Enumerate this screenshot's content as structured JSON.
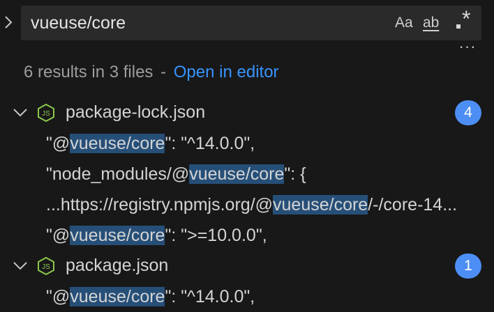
{
  "search": {
    "query": "vueuse/core",
    "match_case_label": "Aa",
    "whole_word_label": "ab",
    "regex_label": "*",
    "more_label": "···"
  },
  "summary": {
    "results_text": "6 results in 3 files",
    "separator": "-",
    "open_in_editor": "Open in editor"
  },
  "files": [
    {
      "name": "package-lock.json",
      "count": "4",
      "matches": [
        {
          "pre": "\"@",
          "match": "vueuse/core",
          "post": "\": \"^14.0.0\","
        },
        {
          "pre": "\"node_modules/@",
          "match": "vueuse/core",
          "post": "\": {"
        },
        {
          "pre": "...https://registry.npmjs.org/@",
          "match": "vueuse/core",
          "post": "/-/core-14..."
        },
        {
          "pre": "\"@",
          "match": "vueuse/core",
          "post": "\": \">=10.0.0\","
        }
      ]
    },
    {
      "name": "package.json",
      "count": "1",
      "matches": [
        {
          "pre": "\"@",
          "match": "vueuse/core",
          "post": "\": \"^14.0.0\","
        }
      ]
    }
  ],
  "colors": {
    "background": "#181818",
    "input_background": "#2a2a2a",
    "link": "#3794ff",
    "badge": "#4d8ef5",
    "match_highlight": "#264f78",
    "node_icon": "#8cc84b"
  },
  "icons": {
    "collapse_toggle": "chevron-right-icon",
    "file_expand": "chevron-down-icon",
    "file_type": "nodejs-icon"
  }
}
